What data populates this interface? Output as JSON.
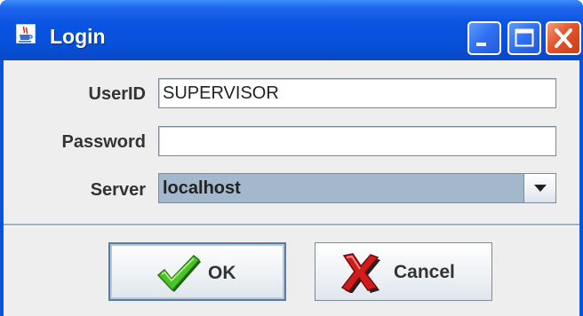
{
  "window": {
    "title": "Login",
    "icon": "java-cup-icon",
    "controls": [
      "minimize-icon",
      "maximize-icon",
      "close-icon"
    ]
  },
  "form": {
    "userid_label": "UserID",
    "userid_value": "SUPERVISOR",
    "password_label": "Password",
    "password_value": "",
    "server_label": "Server",
    "server_value": "localhost"
  },
  "buttons": {
    "ok_label": "OK",
    "ok_icon": "green-checkmark-icon",
    "cancel_label": "Cancel",
    "cancel_icon": "red-x-icon"
  },
  "colors": {
    "titlebar": "#0a54e3",
    "client_bg": "#eeeeee",
    "combo_bg": "#a3b8cc",
    "close_button": "#e2542b"
  }
}
